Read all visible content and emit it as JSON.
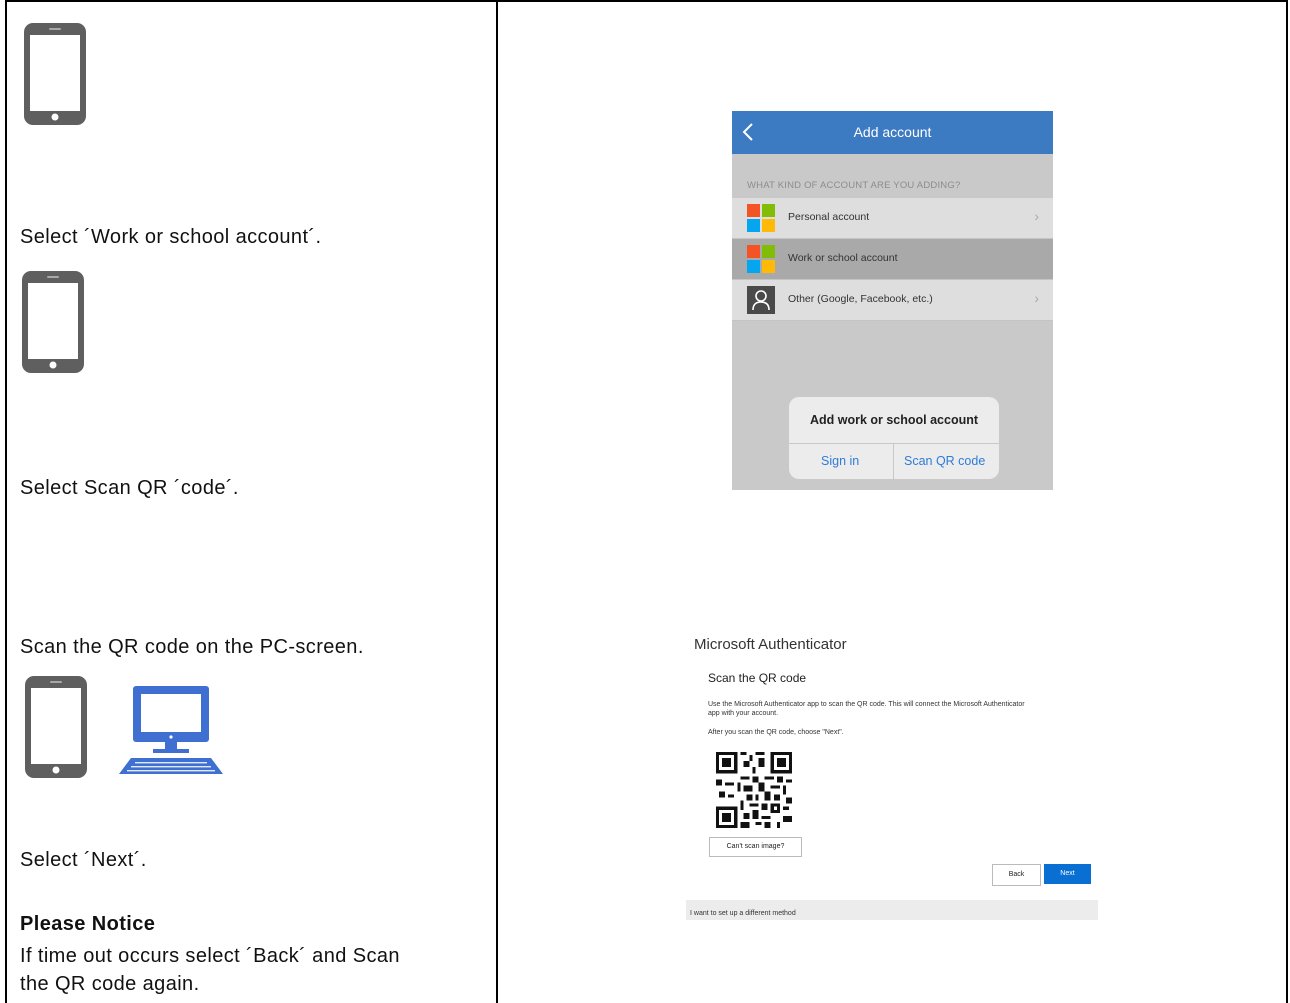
{
  "steps": {
    "step1": "Select ´Work or school account´.",
    "step2": "Select Scan QR ´code´.",
    "step3": "Scan the QR code on the PC-screen.",
    "step4": "Select ´Next´.",
    "notice_title": "Please Notice",
    "notice_line1": "If time out occurs select ´Back´ and Scan",
    "notice_line2": "the QR code again."
  },
  "phone_screen": {
    "title": "Add account",
    "section": "WHAT KIND OF ACCOUNT ARE YOU ADDING?",
    "rows": [
      {
        "label": "Personal account"
      },
      {
        "label": "Work or school account"
      },
      {
        "label": "Other (Google, Facebook, etc.)"
      }
    ],
    "dialog": {
      "title": "Add work or school account",
      "sign_in": "Sign in",
      "scan": "Scan QR code"
    },
    "colors": {
      "header": "#3c7ac2",
      "link": "#2f7bd8"
    }
  },
  "authenticator": {
    "title": "Microsoft Authenticator",
    "subtitle": "Scan the QR code",
    "para1_line1": "Use the Microsoft Authenticator app to scan the QR code. This will connect the Microsoft Authenticator",
    "para1_line2": "app with your account.",
    "para2": "After you scan the QR code, choose \"Next\".",
    "cant_scan": "Can't scan image?",
    "back": "Back",
    "next": "Next",
    "footer": "I want to set up a different method",
    "colors": {
      "next": "#0a6fd2"
    }
  },
  "icons": {
    "phone": "mobile-phone-icon",
    "pc": "desktop-computer-icon"
  }
}
